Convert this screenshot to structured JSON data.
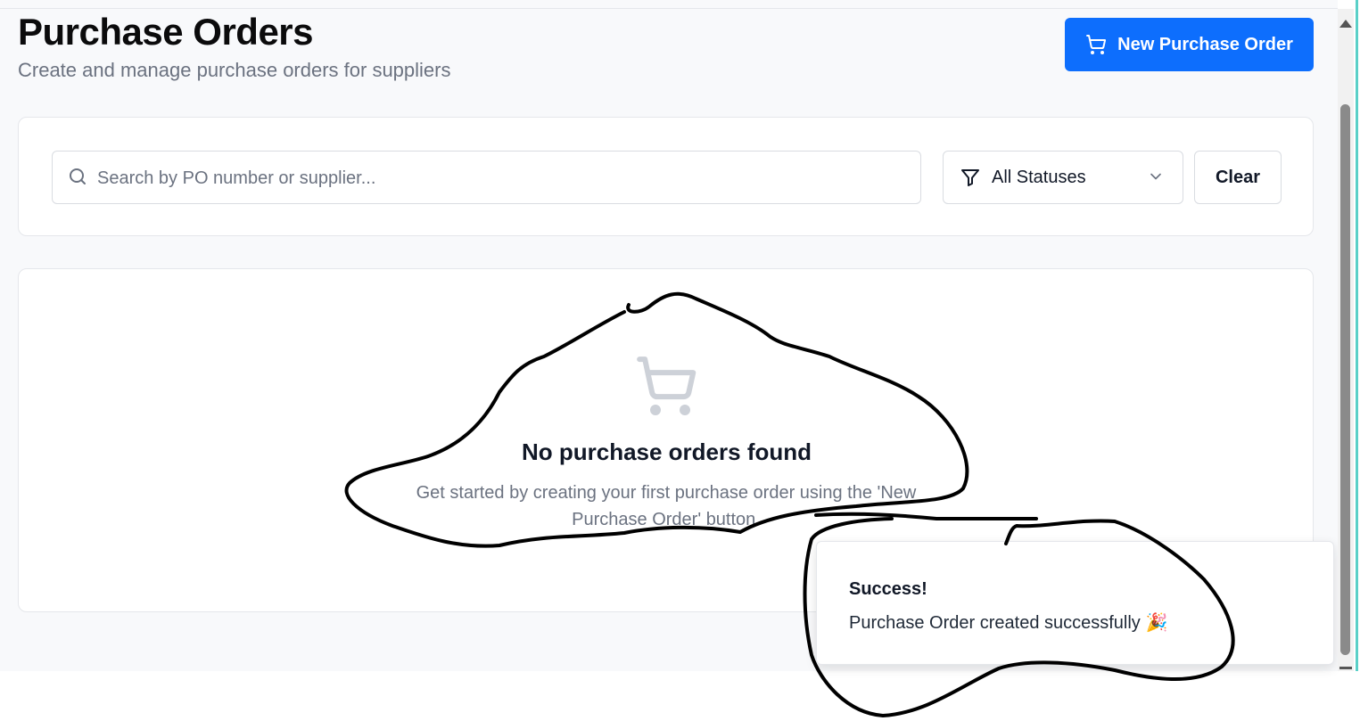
{
  "header": {
    "title": "Purchase Orders",
    "subtitle": "Create and manage purchase orders for suppliers",
    "new_button_label": "New Purchase Order"
  },
  "filters": {
    "search_placeholder": "Search by PO number or supplier...",
    "search_value": "",
    "status_selected": "All Statuses",
    "clear_label": "Clear"
  },
  "empty_state": {
    "icon": "shopping-cart-icon",
    "title": "No purchase orders found",
    "description": "Get started by creating your first purchase order using the 'New Purchase Order' button."
  },
  "toast": {
    "title": "Success!",
    "message": "Purchase Order created successfully",
    "emoji": "🎉"
  },
  "colors": {
    "primary": "#0d6efd",
    "background": "#f8f9fb",
    "muted_text": "#6b7280",
    "annotation_ink": "#000000"
  }
}
